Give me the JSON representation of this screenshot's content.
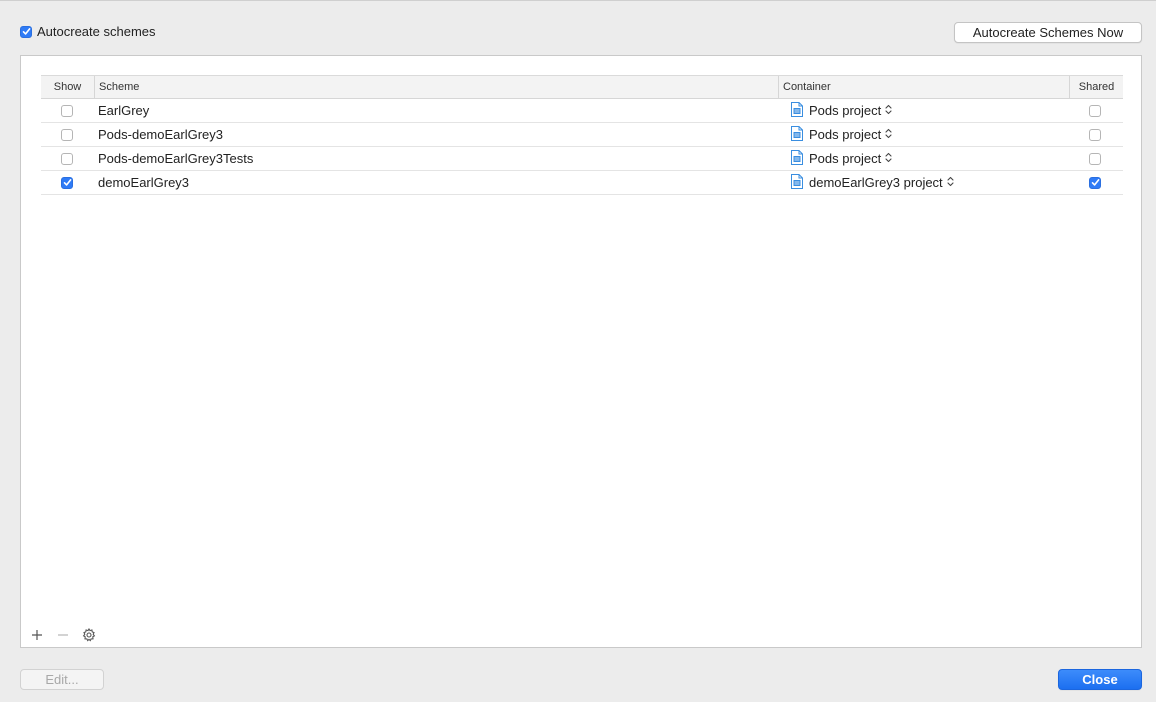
{
  "autocreate": {
    "label": "Autocreate schemes",
    "checked": true
  },
  "buttons": {
    "autocreate_now": "Autocreate Schemes Now",
    "edit": "Edit...",
    "close": "Close"
  },
  "table": {
    "headers": {
      "show": "Show",
      "scheme": "Scheme",
      "container": "Container",
      "shared": "Shared"
    },
    "rows": [
      {
        "show": false,
        "scheme": "EarlGrey",
        "container": "Pods project",
        "shared": false
      },
      {
        "show": false,
        "scheme": "Pods-demoEarlGrey3",
        "container": "Pods project",
        "shared": false
      },
      {
        "show": false,
        "scheme": "Pods-demoEarlGrey3Tests",
        "container": "Pods project",
        "shared": false
      },
      {
        "show": true,
        "scheme": "demoEarlGrey3",
        "container": "demoEarlGrey3 project",
        "shared": true
      }
    ]
  },
  "toolbar": {
    "icons": [
      "plus-icon",
      "minus-icon",
      "gear-icon"
    ]
  },
  "colors": {
    "accent": "#2f7bf6",
    "close_button": "#1c6ff0"
  }
}
